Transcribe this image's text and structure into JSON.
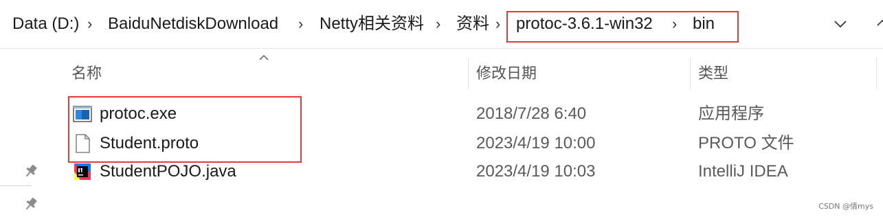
{
  "address_bar": {
    "crumbs": [
      "Data (D:)",
      "BaiduNetdiskDownload",
      "Netty相关资料",
      "资料",
      "protoc-3.6.1-win32",
      "bin"
    ],
    "separator": "›"
  },
  "columns": [
    "名称",
    "修改日期",
    "类型"
  ],
  "files": [
    {
      "name": "protoc.exe",
      "modified": "2018/7/28 6:40",
      "type": "应用程序",
      "icon": "exe-icon"
    },
    {
      "name": "Student.proto",
      "modified": "2023/4/19 10:00",
      "type": "PROTO 文件",
      "icon": "document-icon"
    },
    {
      "name": "StudentPOJO.java",
      "modified": "2023/4/19 10:03",
      "type": "IntelliJ IDEA",
      "icon": "intellij-idea-icon"
    }
  ],
  "watermark": "CSDN @倩mys",
  "colors": {
    "highlight_border": "#e23b3b",
    "exe_blue": "#1f7fd1"
  }
}
